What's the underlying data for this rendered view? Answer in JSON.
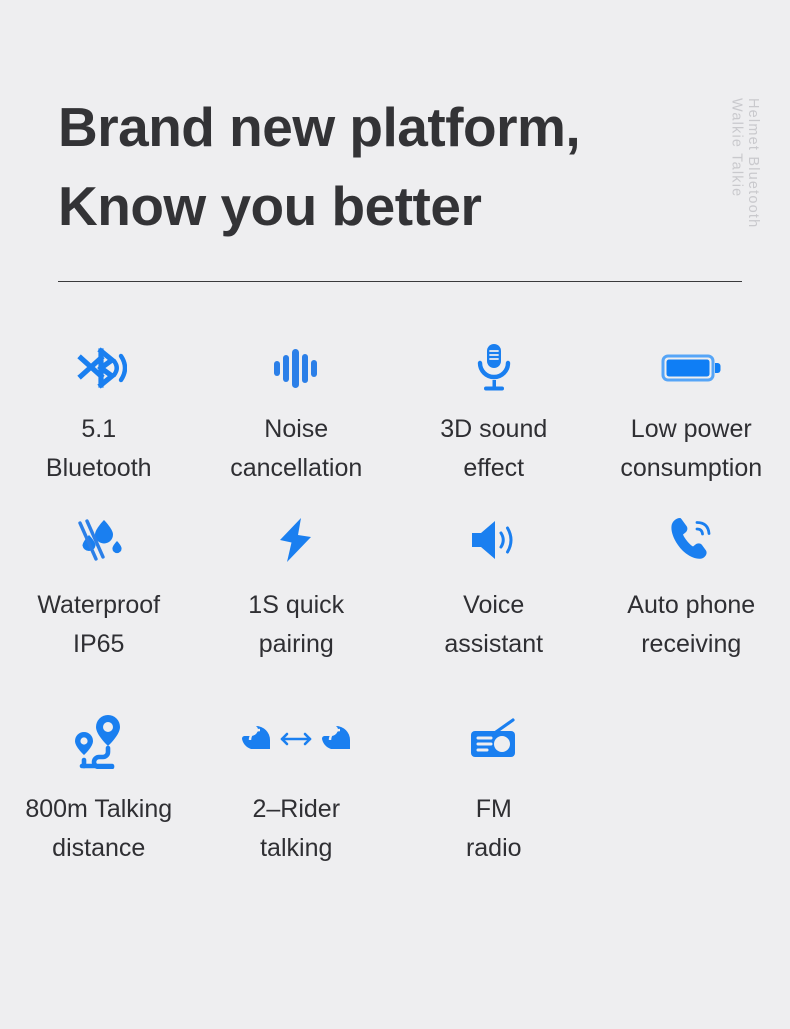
{
  "header": {
    "headline_line1": "Brand new platform,",
    "headline_line2": "Know you better",
    "side_label_1": "Helmet Bluetooth",
    "side_label_2": "Walkie Talkie"
  },
  "colors": {
    "background": "#eeeef0",
    "accent_blue": "#1180f5",
    "accent_blue_dark": "#1f6ae0",
    "heading_text": "#333336",
    "caption_text": "#2f2f33",
    "side_label_text": "#c9c9cd",
    "divider": "#3a3a3c"
  },
  "features": {
    "rows": [
      [
        {
          "icon": "bluetooth-icon",
          "label": "5.1\nBluetooth"
        },
        {
          "icon": "sound-wave-bars-icon",
          "label": "Noise\ncancellation"
        },
        {
          "icon": "microphone-icon",
          "label": "3D sound\neffect"
        },
        {
          "icon": "battery-full-icon",
          "label": "Low power\nconsumption"
        }
      ],
      [
        {
          "icon": "waterproof-icon",
          "label": "Waterproof\nIP65"
        },
        {
          "icon": "lightning-bolt-icon",
          "label": "1S quick\npairing"
        },
        {
          "icon": "speaker-volume-icon",
          "label": "Voice\nassistant"
        },
        {
          "icon": "phone-call-icon",
          "label": "Auto phone\nreceiving"
        }
      ],
      [
        {
          "icon": "route-map-pins-icon",
          "label": "800m Talking\ndistance"
        },
        {
          "icon": "two-helmets-talking-icon",
          "label": "2–Rider\ntalking"
        },
        {
          "icon": "fm-radio-icon",
          "label": "FM\nradio"
        }
      ]
    ]
  }
}
